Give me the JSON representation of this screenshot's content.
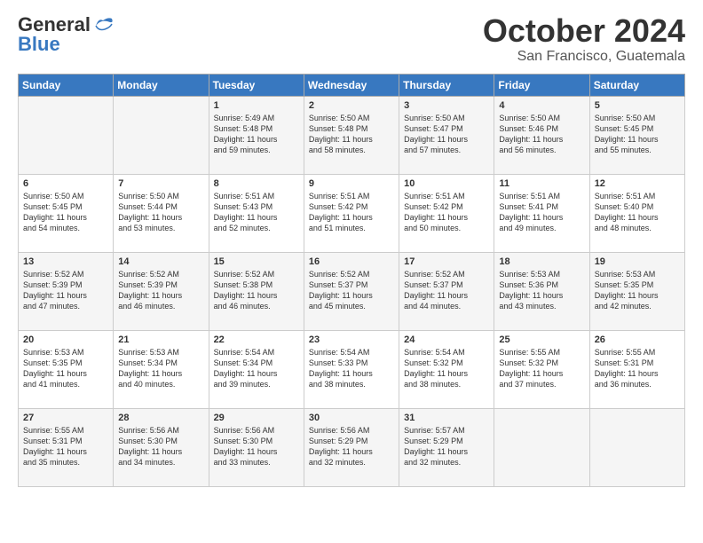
{
  "header": {
    "logo_general": "General",
    "logo_blue": "Blue",
    "month_title": "October 2024",
    "location": "San Francisco, Guatemala"
  },
  "days_of_week": [
    "Sunday",
    "Monday",
    "Tuesday",
    "Wednesday",
    "Thursday",
    "Friday",
    "Saturday"
  ],
  "weeks": [
    [
      {
        "day": "",
        "content": ""
      },
      {
        "day": "",
        "content": ""
      },
      {
        "day": "1",
        "content": "Sunrise: 5:49 AM\nSunset: 5:48 PM\nDaylight: 11 hours\nand 59 minutes."
      },
      {
        "day": "2",
        "content": "Sunrise: 5:50 AM\nSunset: 5:48 PM\nDaylight: 11 hours\nand 58 minutes."
      },
      {
        "day": "3",
        "content": "Sunrise: 5:50 AM\nSunset: 5:47 PM\nDaylight: 11 hours\nand 57 minutes."
      },
      {
        "day": "4",
        "content": "Sunrise: 5:50 AM\nSunset: 5:46 PM\nDaylight: 11 hours\nand 56 minutes."
      },
      {
        "day": "5",
        "content": "Sunrise: 5:50 AM\nSunset: 5:45 PM\nDaylight: 11 hours\nand 55 minutes."
      }
    ],
    [
      {
        "day": "6",
        "content": "Sunrise: 5:50 AM\nSunset: 5:45 PM\nDaylight: 11 hours\nand 54 minutes."
      },
      {
        "day": "7",
        "content": "Sunrise: 5:50 AM\nSunset: 5:44 PM\nDaylight: 11 hours\nand 53 minutes."
      },
      {
        "day": "8",
        "content": "Sunrise: 5:51 AM\nSunset: 5:43 PM\nDaylight: 11 hours\nand 52 minutes."
      },
      {
        "day": "9",
        "content": "Sunrise: 5:51 AM\nSunset: 5:42 PM\nDaylight: 11 hours\nand 51 minutes."
      },
      {
        "day": "10",
        "content": "Sunrise: 5:51 AM\nSunset: 5:42 PM\nDaylight: 11 hours\nand 50 minutes."
      },
      {
        "day": "11",
        "content": "Sunrise: 5:51 AM\nSunset: 5:41 PM\nDaylight: 11 hours\nand 49 minutes."
      },
      {
        "day": "12",
        "content": "Sunrise: 5:51 AM\nSunset: 5:40 PM\nDaylight: 11 hours\nand 48 minutes."
      }
    ],
    [
      {
        "day": "13",
        "content": "Sunrise: 5:52 AM\nSunset: 5:39 PM\nDaylight: 11 hours\nand 47 minutes."
      },
      {
        "day": "14",
        "content": "Sunrise: 5:52 AM\nSunset: 5:39 PM\nDaylight: 11 hours\nand 46 minutes."
      },
      {
        "day": "15",
        "content": "Sunrise: 5:52 AM\nSunset: 5:38 PM\nDaylight: 11 hours\nand 46 minutes."
      },
      {
        "day": "16",
        "content": "Sunrise: 5:52 AM\nSunset: 5:37 PM\nDaylight: 11 hours\nand 45 minutes."
      },
      {
        "day": "17",
        "content": "Sunrise: 5:52 AM\nSunset: 5:37 PM\nDaylight: 11 hours\nand 44 minutes."
      },
      {
        "day": "18",
        "content": "Sunrise: 5:53 AM\nSunset: 5:36 PM\nDaylight: 11 hours\nand 43 minutes."
      },
      {
        "day": "19",
        "content": "Sunrise: 5:53 AM\nSunset: 5:35 PM\nDaylight: 11 hours\nand 42 minutes."
      }
    ],
    [
      {
        "day": "20",
        "content": "Sunrise: 5:53 AM\nSunset: 5:35 PM\nDaylight: 11 hours\nand 41 minutes."
      },
      {
        "day": "21",
        "content": "Sunrise: 5:53 AM\nSunset: 5:34 PM\nDaylight: 11 hours\nand 40 minutes."
      },
      {
        "day": "22",
        "content": "Sunrise: 5:54 AM\nSunset: 5:34 PM\nDaylight: 11 hours\nand 39 minutes."
      },
      {
        "day": "23",
        "content": "Sunrise: 5:54 AM\nSunset: 5:33 PM\nDaylight: 11 hours\nand 38 minutes."
      },
      {
        "day": "24",
        "content": "Sunrise: 5:54 AM\nSunset: 5:32 PM\nDaylight: 11 hours\nand 38 minutes."
      },
      {
        "day": "25",
        "content": "Sunrise: 5:55 AM\nSunset: 5:32 PM\nDaylight: 11 hours\nand 37 minutes."
      },
      {
        "day": "26",
        "content": "Sunrise: 5:55 AM\nSunset: 5:31 PM\nDaylight: 11 hours\nand 36 minutes."
      }
    ],
    [
      {
        "day": "27",
        "content": "Sunrise: 5:55 AM\nSunset: 5:31 PM\nDaylight: 11 hours\nand 35 minutes."
      },
      {
        "day": "28",
        "content": "Sunrise: 5:56 AM\nSunset: 5:30 PM\nDaylight: 11 hours\nand 34 minutes."
      },
      {
        "day": "29",
        "content": "Sunrise: 5:56 AM\nSunset: 5:30 PM\nDaylight: 11 hours\nand 33 minutes."
      },
      {
        "day": "30",
        "content": "Sunrise: 5:56 AM\nSunset: 5:29 PM\nDaylight: 11 hours\nand 32 minutes."
      },
      {
        "day": "31",
        "content": "Sunrise: 5:57 AM\nSunset: 5:29 PM\nDaylight: 11 hours\nand 32 minutes."
      },
      {
        "day": "",
        "content": ""
      },
      {
        "day": "",
        "content": ""
      }
    ]
  ]
}
